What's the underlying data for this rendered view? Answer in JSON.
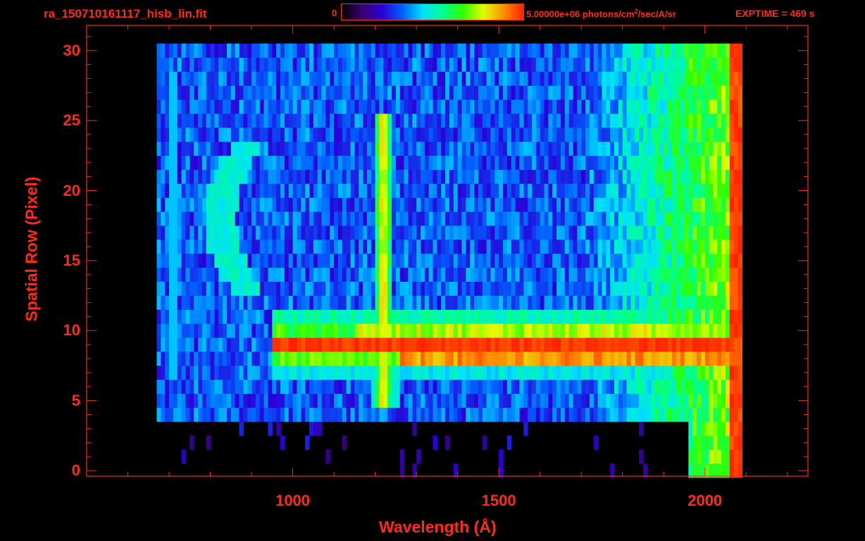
{
  "filename": "ra_150710161117_hisb_lin.fit",
  "colorbar": {
    "min_label": "0",
    "max_label_main": "5.00000e+06 photons/cm",
    "max_label_sup": "2",
    "max_label_tail": "/sec/A/sr",
    "stops": [
      "#000000",
      "#3a0070",
      "#2a00d8",
      "#0060ff",
      "#00e0ff",
      "#00ff90",
      "#30ff00",
      "#e0ff00",
      "#ff9000",
      "#ff2000"
    ]
  },
  "exptime_label": "EXPTIME = 469 s",
  "accent_color": "#ff2a1a",
  "chart_data": {
    "type": "heatmap",
    "title": "",
    "xlabel": "Wavelength (Å)",
    "ylabel": "Spatial Row (Pixel)",
    "xlim": [
      500,
      2250
    ],
    "ylim": [
      -0.4,
      31.8
    ],
    "xticks": [
      1000,
      1500,
      2000
    ],
    "yticks": [
      0,
      5,
      10,
      15,
      20,
      25,
      30
    ],
    "x_data_range": [
      670,
      2070
    ],
    "y_data_range": [
      0,
      30
    ],
    "colorbar_range": [
      0,
      5000000
    ],
    "features": [
      {
        "label": "bright horizontal spectrum",
        "rows": [
          8,
          10
        ],
        "x_range": [
          940,
          2070
        ],
        "level": "max"
      },
      {
        "label": "emission line",
        "x": 1216,
        "rows": [
          5,
          25
        ],
        "level": "high"
      },
      {
        "label": "edge emission",
        "x": 2060,
        "rows": [
          2,
          30
        ],
        "level": "max"
      },
      {
        "label": "curved arc",
        "x_range": [
          790,
          920
        ],
        "rows": [
          13,
          23
        ],
        "level": "medium"
      },
      {
        "label": "faint vertical stripe",
        "x": 705,
        "rows": [
          6,
          29
        ],
        "level": "low"
      }
    ]
  }
}
